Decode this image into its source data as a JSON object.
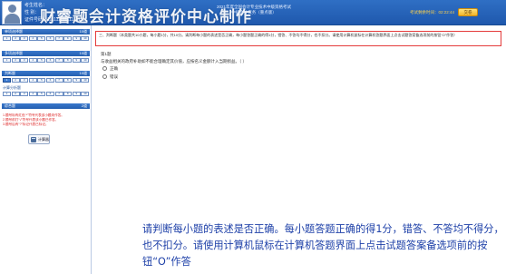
{
  "header": {
    "candidate_name": "考生姓名：",
    "candidate_gender": "性    别：",
    "candidate_id": "证件号码：111111111111111111",
    "watermark": "财睿题会计资格评价中心制作",
    "exam_title_1": "2021年度全国会计专业技术中级资格考试",
    "exam_title_2": "中级会计实务（重点版）",
    "exam_title_3": "",
    "time_left": "考试剩余时间：02:22:44",
    "submit_label": "交卷"
  },
  "sidebar": {
    "section1": {
      "title": "单项选择题",
      "count": "10道"
    },
    "section2": {
      "title": "多项选择题",
      "count": "10道"
    },
    "section3": {
      "title": "判断题",
      "count": "10道"
    },
    "section4_sub": "计算分析题",
    "section5": {
      "title": "综合题",
      "count": "2道"
    },
    "legend": [
      "1.题号标有红色“*”符号代表该小题未作答。",
      "2.题号前打“√”符号代表该小题已作答。",
      "3.题号后有“?”标记代表已标记。"
    ],
    "calc_label": "计算器",
    "grid1": [
      "1",
      "2",
      "3",
      "4",
      "5",
      "6",
      "7",
      "8",
      "9",
      "10"
    ],
    "grid2": [
      "1",
      "2",
      "3",
      "4",
      "5",
      "6",
      "7",
      "8",
      "9",
      "10"
    ],
    "grid3": [
      "1",
      "2",
      "3",
      "4",
      "5",
      "6",
      "7",
      "8",
      "9",
      "10"
    ],
    "grid4": [
      "1",
      "2",
      "3",
      "4",
      "5",
      "6",
      "7",
      "8",
      "9",
      "10"
    ]
  },
  "main": {
    "instruction": "三、判断题（本类题共10小题，每小题1分，共10分。请判断每小题的表述是否正确，每小题答题正确的得1分，错答、不答均不得分，也不扣分。请使用计算机鼠标在计算机答题界面上点击试题答案备选项前的按钮“O”作答）",
    "question_number": "第1题",
    "question_stem": "与收益相关的政府补助如不能合理确定其价值，应按名义金额计入当期损益。（    ）",
    "options": [
      "正确",
      "错误"
    ]
  },
  "caption": "请判断每小题的表述是否正确。每小题答题正确的得1分，错答、不答均不得分，也不扣分。请使用计算机鼠标在计算机答题界面上点击试题答案备选项前的按钮“O”作答"
}
